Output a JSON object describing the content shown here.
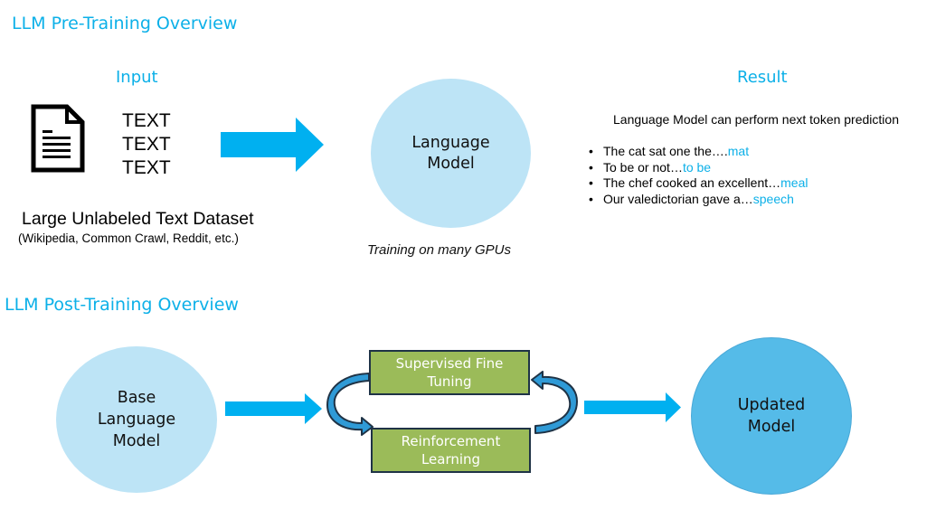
{
  "pre_training": {
    "title": "LLM Pre-Training Overview",
    "input_label": "Input",
    "text_tokens": [
      "TEXT",
      "TEXT",
      "TEXT"
    ],
    "dataset_title": "Large Unlabeled Text Dataset",
    "dataset_sources": "(Wikipedia, Common Crawl, Reddit, etc.)",
    "model_label_line1": "Language",
    "model_label_line2": "Model",
    "training_note": "Training on many GPUs",
    "result_label": "Result",
    "result_description": "Language Model can perform next token prediction",
    "examples": [
      {
        "prompt": "The cat sat one the….",
        "prediction": "mat"
      },
      {
        "prompt": "To be or not…",
        "prediction": "to be"
      },
      {
        "prompt": "The chef cooked an excellent…",
        "prediction": "meal"
      },
      {
        "prompt": "Our valedictorian gave a…",
        "prediction": "speech"
      }
    ]
  },
  "post_training": {
    "title": "LLM Post-Training Overview",
    "base_model_line1": "Base",
    "base_model_line2": "Language",
    "base_model_line3": "Model",
    "sft_line1": "Supervised Fine",
    "sft_line2": "Tuning",
    "rl_line1": "Reinforcement",
    "rl_line2": "Learning",
    "updated_model_line1": "Updated",
    "updated_model_line2": "Model"
  },
  "colors": {
    "accent": "#0cb0e8",
    "arrow": "#00b0f0",
    "light_circle": "#bde4f6",
    "dark_circle": "#55bbe8",
    "green_box": "#9bbb59",
    "box_border": "#1f3346"
  }
}
